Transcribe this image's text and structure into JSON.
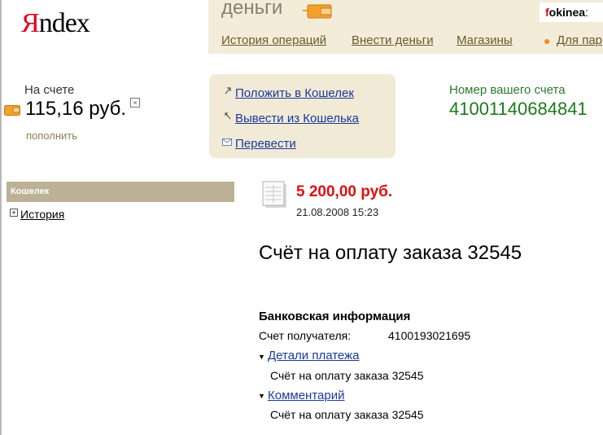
{
  "logo": {
    "first_letter": "Я",
    "rest": "ndex"
  },
  "header": {
    "service_title": "деньги",
    "user": {
      "part1": "f",
      "part2": "okinea",
      "suffix": ":"
    },
    "nav": [
      "История операций",
      "Внести деньги",
      "Магазины",
      "Для пар"
    ]
  },
  "balance": {
    "label": "На счете",
    "value": "115,16 руб.",
    "toggle": "×",
    "topup": "пополнить"
  },
  "actions": {
    "put": "Положить в Кошелек",
    "withdraw": "Вывести из Кошелька",
    "transfer": "Перевести"
  },
  "account": {
    "label": "Номер вашего счета",
    "number": "41001140684841"
  },
  "sidebar": {
    "title": "Кошелек",
    "toggle": "+",
    "items": [
      "История"
    ]
  },
  "payment": {
    "amount": "5 200,00 руб.",
    "datetime": "21.08.2008 15:23",
    "title": "Счёт на оплату заказа 32545",
    "bank_heading": "Банковская информация",
    "recipient_label": "Счет получателя:",
    "recipient_value": "4100193021695",
    "details_link": "Детали платежа",
    "details_text": "Счёт на оплату заказа 32545",
    "comment_link": "Комментарий",
    "comment_text": "Счёт на оплату заказа 32545",
    "caret": "▼"
  },
  "colors": {
    "brand_red": "#e1001a",
    "header_beige": "#f3ecd9",
    "sidebar_header": "#bcb196",
    "amount_red": "#e01010",
    "account_green": "#1c7a1c",
    "link_blue": "#1a3a9c"
  },
  "icons": [
    "wallet-icon",
    "arrow-up-icon",
    "arrow-down-icon",
    "envelope-icon",
    "document-icon",
    "plus-icon",
    "caret-down-icon"
  ]
}
